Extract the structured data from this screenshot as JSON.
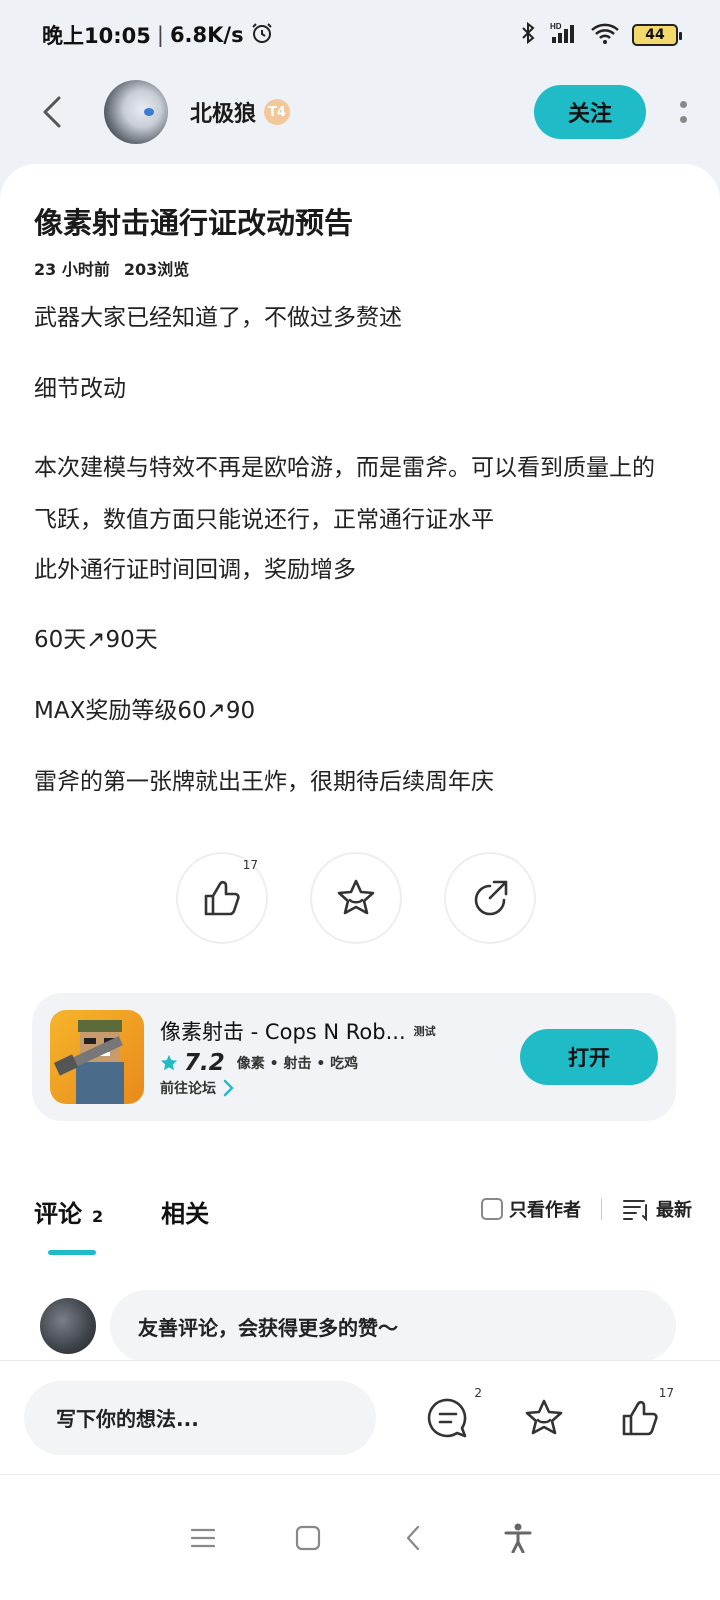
{
  "status_bar": {
    "time": "晚上10:05",
    "speed": "6.8K/s",
    "battery": "44",
    "network_label": "HD"
  },
  "header": {
    "author_name": "北极狼",
    "author_badge": "T4",
    "follow_label": "关注"
  },
  "post": {
    "title": "像素射击通行证改动预告",
    "time_ago": "23 小时前",
    "views": "203浏览",
    "paragraphs": [
      "武器大家已经知道了，不做过多赘述",
      "细节改动",
      "本次建模与特效不再是欧哈游，而是雷斧。可以看到质量上的飞跃，数值方面只能说还行，正常通行证水平",
      "此外通行证时间回调，奖励增多",
      "60天↗90天",
      "MAX奖励等级60↗90",
      "雷斧的第一张牌就出王炸，很期待后续周年庆"
    ]
  },
  "actions": {
    "like_count": "17"
  },
  "game_card": {
    "name": "像素射击 - Cops N Rob...",
    "tag": "测试",
    "rating": "7.2",
    "tags": "像素 • 射击 • 吃鸡",
    "forum_link": "前往论坛",
    "open_label": "打开"
  },
  "comments": {
    "tab_comments": "评论",
    "tab_comments_count": "2",
    "tab_related": "相关",
    "filter_author_only": "只看作者",
    "sort_label": "最新",
    "prompt": "友善评论，会获得更多的赞～"
  },
  "input_bar": {
    "placeholder": "写下你的想法...",
    "comment_count": "2",
    "like_count": "17"
  },
  "colors": {
    "accent": "#1fbcc8",
    "background": "#eef1f5",
    "card": "#ffffff"
  },
  "icons": [
    "back-icon",
    "more-icon",
    "like-icon",
    "star-icon",
    "share-icon",
    "comment-icon",
    "checkbox-icon",
    "sort-icon",
    "menu-icon",
    "home-icon",
    "nav-back-icon",
    "accessibility-icon",
    "bluetooth-icon",
    "signal-icon",
    "wifi-icon",
    "alarm-icon"
  ]
}
